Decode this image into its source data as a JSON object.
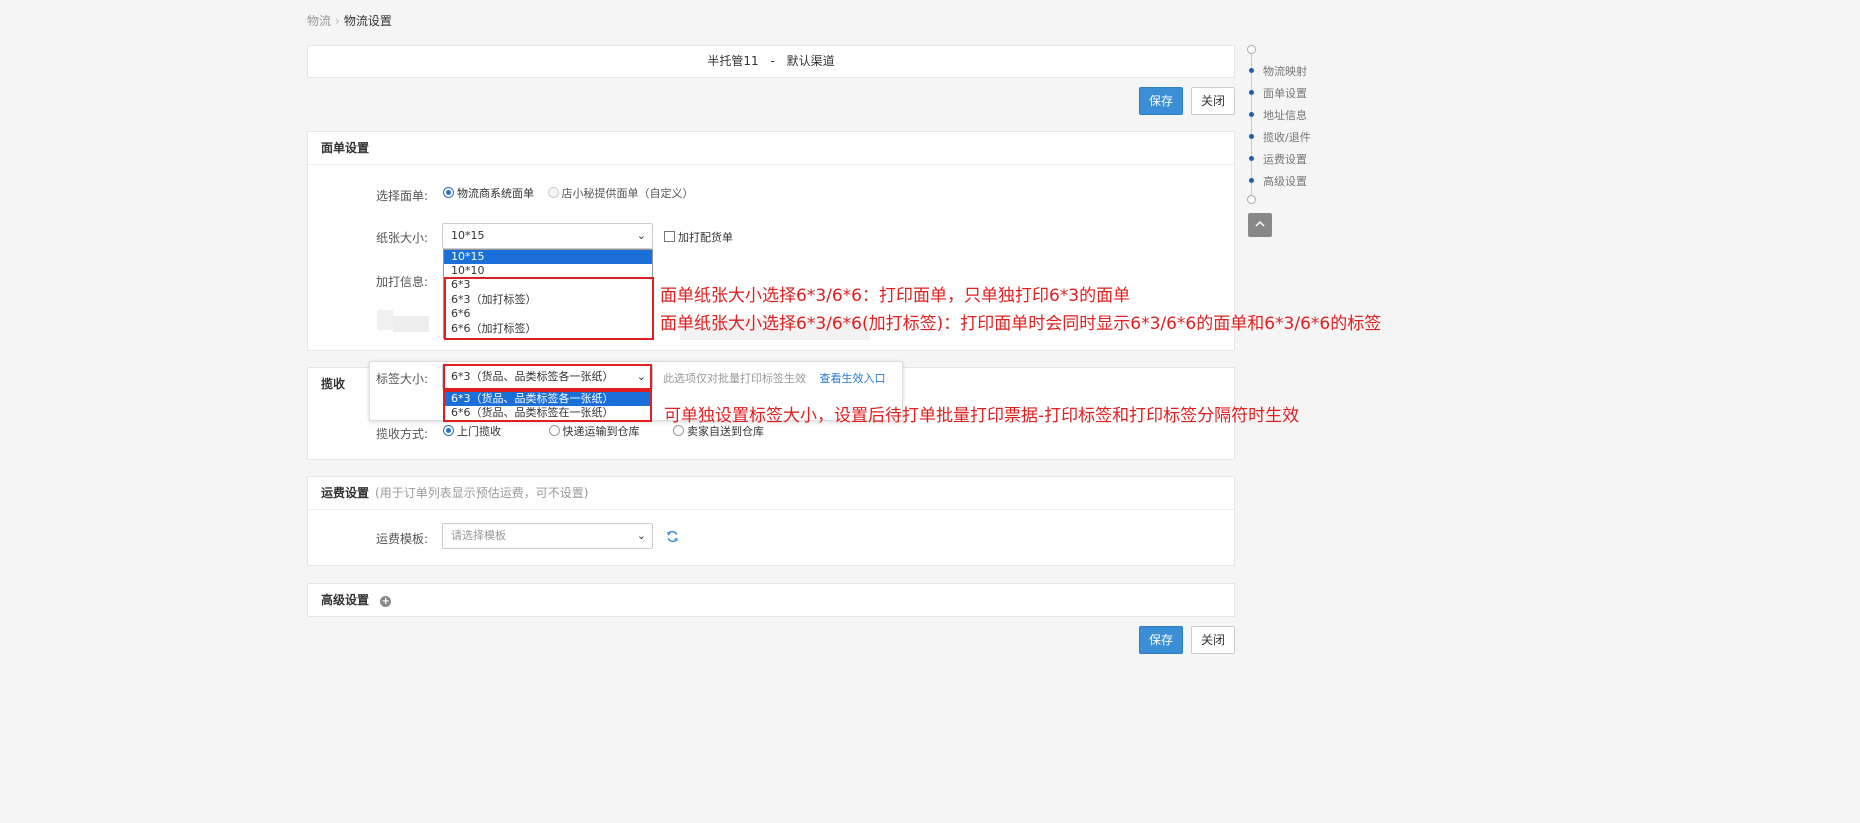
{
  "breadcrumb": {
    "parent": "物流",
    "separator": "›",
    "current": "物流设置"
  },
  "page_title": {
    "store": "半托管11",
    "dash": "-",
    "channel": "默认渠道"
  },
  "actions": {
    "save": "保存",
    "close": "关闭"
  },
  "waybill": {
    "header": "面单设置",
    "select_label": "选择面单:",
    "options": [
      "物流商系统面单",
      "店小秘提供面单（自定义）"
    ],
    "selected_option": 0,
    "paper_label": "纸张大小:",
    "paper_value": "10*15",
    "paper_options": [
      "10*15",
      "10*10",
      "6*3",
      "6*3（加打标签）",
      "6*6",
      "6*6（加打标签）"
    ],
    "print_packing_label": "加打配货单",
    "extra_print_label": "加打信息:"
  },
  "label_size": {
    "label": "标签大小:",
    "value": "6*3（货品、品类标签各一张纸）",
    "options": [
      "6*3（货品、品类标签各一张纸）",
      "6*6（货品、品类标签在一张纸）"
    ],
    "hint": "此选项仅对批量打印标签生效",
    "link": "查看生效入口"
  },
  "pickup": {
    "header": "揽收",
    "method_label": "揽收方式:",
    "options": [
      "上门揽收",
      "快递运输到仓库",
      "卖家自送到仓库"
    ],
    "selected_option": 0
  },
  "freight": {
    "header": "运费设置",
    "hint": "(用于订单列表显示预估运费，可不设置)",
    "template_label": "运费模板:",
    "template_placeholder": "请选择模板"
  },
  "advanced": {
    "header": "高级设置"
  },
  "annotations": {
    "paper_line1": "面单纸张大小选择6*3/6*6：打印面单，只单独打印6*3的面单",
    "paper_line2": "面单纸张大小选择6*3/6*6(加打标签)：打印面单时会同时显示6*3/6*6的面单和6*3/6*6的标签",
    "label_line": "可单独设置标签大小，设置后待打单批量打印票据-打印标签和打印标签分隔符时生效"
  },
  "side_nav": [
    "物流映射",
    "面单设置",
    "地址信息",
    "揽收/退件",
    "运费设置",
    "高级设置"
  ],
  "icons": {
    "chevron": "chevron-down-icon",
    "refresh": "refresh-icon",
    "plus": "plus-circle-icon",
    "scroll_top": "chevron-up-icon"
  },
  "colors": {
    "primary": "#3a8fd6",
    "selected_option": "#1a6fd9",
    "annotation": "#e02020",
    "nav_dot": "#1f5fa8"
  }
}
